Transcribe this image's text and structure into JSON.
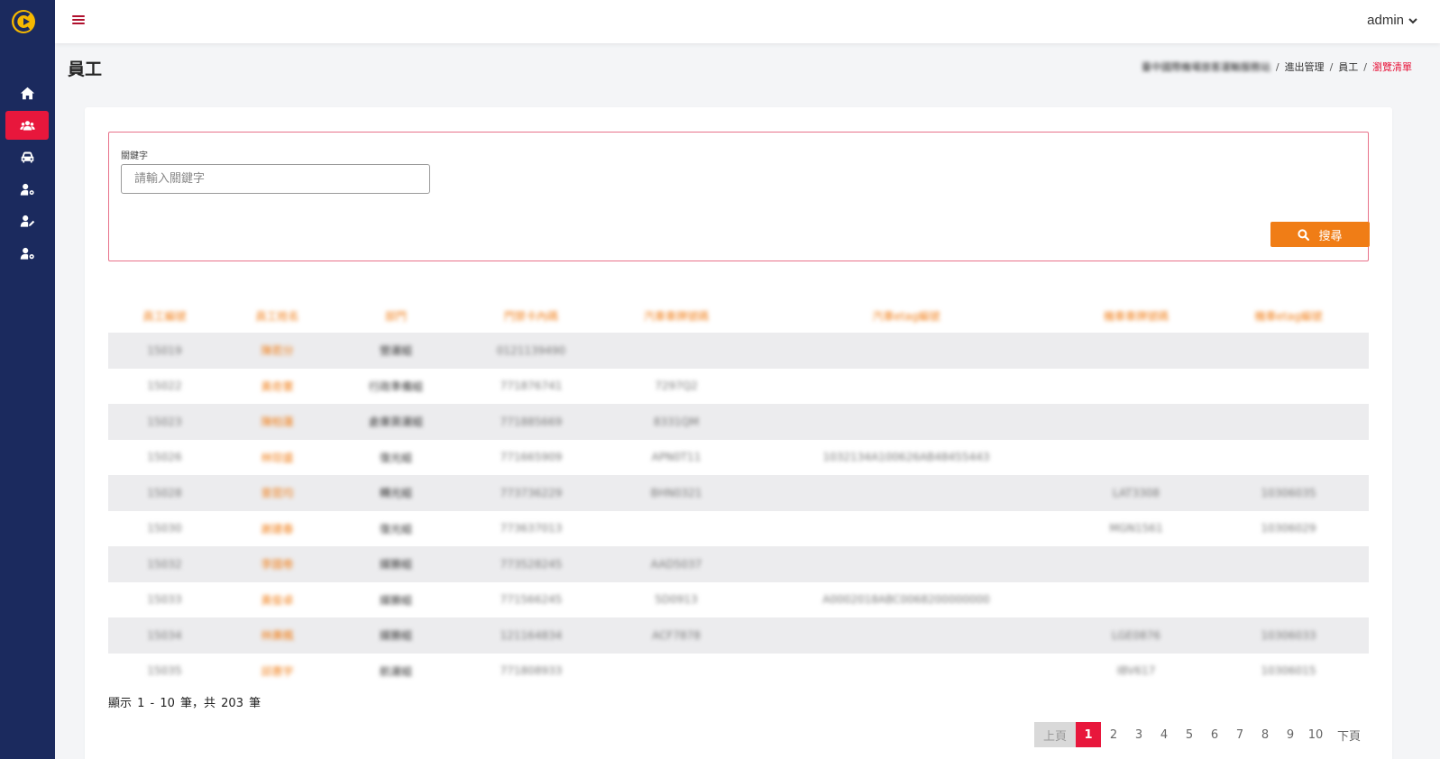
{
  "topbar": {
    "username": "admin"
  },
  "page": {
    "title": "員工",
    "breadcrumb": [
      "臺中國際機場旅客運輸服務站",
      "進出管理",
      "員工",
      "瀏覽清單"
    ]
  },
  "search": {
    "label": "關鍵字",
    "placeholder": "請輸入關鍵字",
    "button_label": "搜尋"
  },
  "table": {
    "columns": [
      "員工編號",
      "員工姓名",
      "部門",
      "門禁卡內碼",
      "汽車車牌號碼",
      "汽車etag編號",
      "機車車牌號碼",
      "機車etag編號"
    ],
    "rows": [
      [
        "15019",
        "陳若分",
        "營運組",
        "0121139490",
        "",
        "",
        "",
        ""
      ],
      [
        "15022",
        "黃奇寰",
        "行政準備組",
        "771876741",
        "7297Q2",
        "",
        "",
        ""
      ],
      [
        "15023",
        "陳柏蓮",
        "倉庫貨運組",
        "771885669",
        "8331QM",
        "",
        "",
        ""
      ],
      [
        "15026",
        "林琮盛",
        "復光組",
        "771665909",
        "APN0T11",
        "1032134A100626AB48455443",
        "",
        ""
      ],
      [
        "15028",
        "曾昆均",
        "轉光組",
        "773736229",
        "BHN0321",
        "",
        "LAT3308",
        "10306035"
      ],
      [
        "15030",
        "謝建春",
        "復光組",
        "773637013",
        "",
        "",
        "MGN1561",
        "10306029"
      ],
      [
        "15032",
        "李國卷",
        "媒勝組",
        "773528245",
        "AAD5037",
        "",
        "",
        ""
      ],
      [
        "15033",
        "黃俊卓",
        "媒勝組",
        "771566245",
        "5D0913",
        "A0002018ABC0068200000000",
        "",
        ""
      ],
      [
        "15034",
        "林廣楓",
        "媒勝組",
        "121164834",
        "ACF7878",
        "",
        "LGE0876",
        "10306033"
      ],
      [
        "15035",
        "邱惠宇",
        "航運組",
        "771808933",
        "",
        "",
        "IBV617",
        "10306015"
      ]
    ]
  },
  "summary": "顯示 1 - 10 筆，共 203 筆",
  "pagination": {
    "prev": "上頁",
    "pages": [
      "1",
      "2",
      "3",
      "4",
      "5",
      "6",
      "7",
      "8",
      "9",
      "10"
    ],
    "current": "1",
    "next": "下頁"
  },
  "colors": {
    "sidebar": "#1b2a5e",
    "accent": "#e8173c",
    "orange": "#f07d16"
  },
  "icons": {
    "sidebar": [
      "home-icon",
      "users-icon",
      "car-icon",
      "user-gear-icon",
      "user-edit-icon",
      "user-cog-icon"
    ]
  }
}
